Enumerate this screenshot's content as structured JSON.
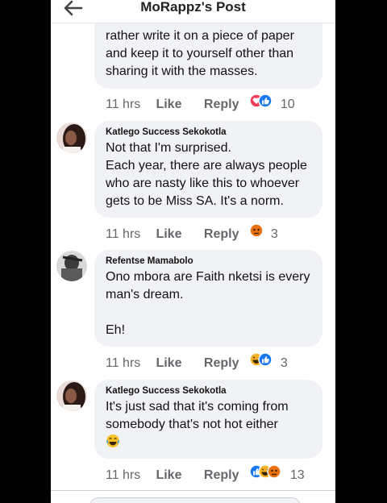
{
  "header": {
    "title": "MoRappz's Post",
    "back_icon": "back-arrow-icon"
  },
  "comments": [
    {
      "text": "rather write it on a piece of paper\nand keep it to yourself other than\nsharing it with the masses.",
      "time": "11 hrs",
      "like": "Like",
      "reply": "Reply",
      "reactions": [
        "love",
        "like"
      ],
      "count": "10"
    },
    {
      "author": "Katlego Success Sekokotla",
      "text": "Not that I'm surprised.\nEach year, there are always people\nwho are nasty like this to whoever\ngets to be Miss SA. It's a norm.",
      "time": "11 hrs",
      "like": "Like",
      "reply": "Reply",
      "reactions": [
        "angry"
      ],
      "count": "3"
    },
    {
      "author": "Refentse Mamabolo",
      "text": "Ono mbora are Faith nketsi is every\nman's dream.\n\nEh!",
      "time": "11 hrs",
      "like": "Like",
      "reply": "Reply",
      "reactions": [
        "haha",
        "like"
      ],
      "count": "3"
    },
    {
      "author": "Katlego Success Sekokotla",
      "text": "It's just sad that it's coming from\nsomebody that's not hot either",
      "emoji": "joy-emoji",
      "time": "11 hrs",
      "like": "Like",
      "reply": "Reply",
      "reactions": [
        "like",
        "haha",
        "angry"
      ],
      "count": "13"
    }
  ],
  "colors": {
    "bubble": "#f0f2f5",
    "meta": "#65676b",
    "like_blue": "#1877f2",
    "love_red": "#f33e58",
    "angry_orange": "#e9710f",
    "haha_yellow": "#f7b125"
  }
}
